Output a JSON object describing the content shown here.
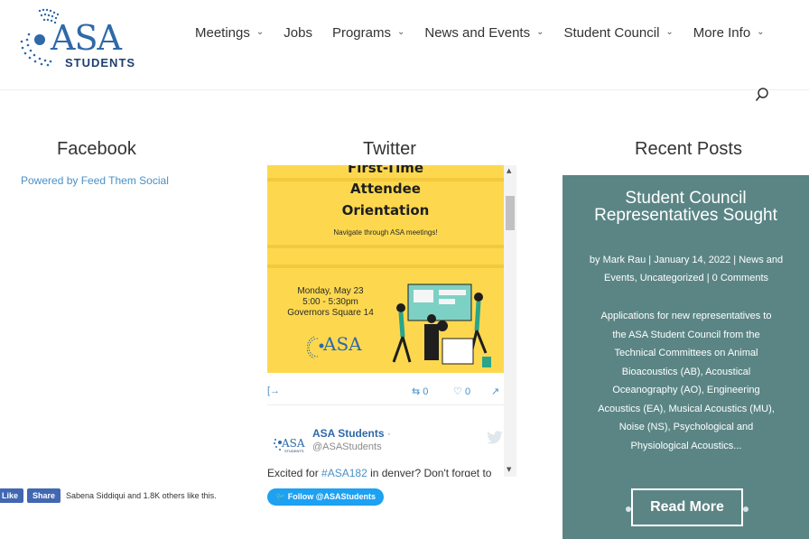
{
  "header": {
    "logo_text": "ASA",
    "logo_subtext": "STUDENTS",
    "nav": [
      {
        "label": "Meetings",
        "dropdown": true
      },
      {
        "label": "Jobs",
        "dropdown": false
      },
      {
        "label": "Programs",
        "dropdown": true
      },
      {
        "label": "News and Events",
        "dropdown": true
      },
      {
        "label": "Student Council",
        "dropdown": true
      },
      {
        "label": "More Info",
        "dropdown": true
      }
    ]
  },
  "facebook": {
    "title": "Facebook",
    "powered_by": "Powered by Feed Them Social",
    "like_label": "Like",
    "share_label": "Share",
    "likes_text": "Sabena Siddiqui and 1.8K others like this."
  },
  "twitter": {
    "title": "Twitter",
    "image": {
      "line1": "First-Time",
      "line2": "Attendee",
      "line3": "Orientation",
      "subtitle": "Navigate through ASA meetings!",
      "date": "Monday, May 23",
      "time": "5:00 - 5:30pm",
      "location": "Governors Square 14",
      "logo_text": "ASA"
    },
    "actions": {
      "retweets": "0",
      "likes": "0"
    },
    "account_name": "ASA Students",
    "account_suffix": " ·",
    "handle": "@ASAStudents",
    "tweet_prefix": "Excited for ",
    "tweet_hashtag": "#ASA182",
    "tweet_rest": " in denver? Don't forget to",
    "follow_label": "Follow @ASAStudents"
  },
  "recent_posts": {
    "title": "Recent Posts",
    "post": {
      "title": "Student Council Representatives Sought",
      "meta": "by Mark Rau | January 14, 2022 | News and Events, Uncategorized | 0 Comments",
      "excerpt": "Applications for new representatives to the ASA Student Council from the Technical Committees on Animal Bioacoustics (AB), Acoustical Oceanography (AO), Engineering Acoustics (EA), Musical Acoustics (MU), Noise (NS), Psychological and Physiological Acoustics...",
      "read_more": "Read More"
    }
  },
  "colors": {
    "brand_blue": "#2e69a9",
    "link_blue": "#4a90c7",
    "post_card": "#5b8585",
    "twitter_blue": "#1da1f2",
    "facebook_blue": "#4267b2",
    "poster_yellow": "#fdd84f"
  },
  "icons": [
    "search-icon",
    "chevron-down-icon",
    "twitter-bird-icon",
    "retweet-icon",
    "heart-icon",
    "share-icon",
    "external-link-icon"
  ]
}
